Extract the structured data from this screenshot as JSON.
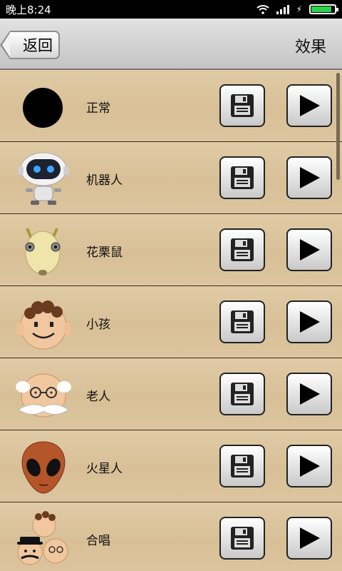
{
  "status": {
    "time": "晚上8:24"
  },
  "titlebar": {
    "back_label": "返回",
    "title": "效果"
  },
  "effects": [
    {
      "label": "正常",
      "icon": "black-circle-icon"
    },
    {
      "label": "机器人",
      "icon": "robot-icon"
    },
    {
      "label": "花栗鼠",
      "icon": "chipmunk-icon"
    },
    {
      "label": "小孩",
      "icon": "child-face-icon"
    },
    {
      "label": "老人",
      "icon": "old-man-face-icon"
    },
    {
      "label": "火星人",
      "icon": "alien-face-icon"
    },
    {
      "label": "合唱",
      "icon": "chorus-faces-icon"
    }
  ],
  "row_actions": {
    "save_icon": "floppy-disk-icon",
    "play_icon": "play-icon"
  },
  "colors": {
    "background": "#d9c19a",
    "titlebar": "#d0d0d0"
  }
}
